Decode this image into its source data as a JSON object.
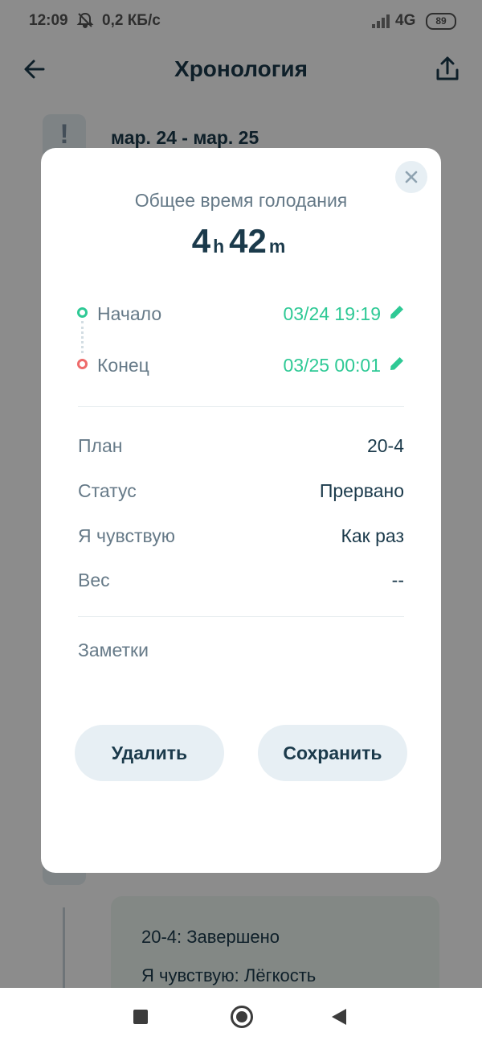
{
  "status_bar": {
    "time": "12:09",
    "speed": "0,2 КБ/с",
    "network": "4G",
    "battery": "89",
    "icons": [
      "muted-bell-icon",
      "signal-icon"
    ]
  },
  "app_bar": {
    "title": "Хронология",
    "back_icon": "arrow-left-icon",
    "share_icon": "share-icon"
  },
  "timeline": {
    "badge_mark": "!",
    "date_range": "мар. 24 - мар. 25",
    "card": {
      "line1": "20-4: Завершено",
      "line2": "Я чувствую: Лёгкость"
    }
  },
  "dialog": {
    "title": "Общее время голодания",
    "duration": {
      "hours": "4",
      "hours_unit": "h",
      "minutes": "42",
      "minutes_unit": "m"
    },
    "start": {
      "label": "Начало",
      "value": "03/24 19:19"
    },
    "end": {
      "label": "Конец",
      "value": "03/25 00:01"
    },
    "details": [
      {
        "label": "План",
        "value": "20-4"
      },
      {
        "label": "Статус",
        "value": "Прервано"
      },
      {
        "label": "Я чувствую",
        "value": "Как раз"
      },
      {
        "label": "Вес",
        "value": "--"
      }
    ],
    "notes_label": "Заметки",
    "delete_label": "Удалить",
    "save_label": "Сохранить"
  },
  "colors": {
    "accent_green": "#2ec995",
    "accent_red": "#ee6b6b",
    "text_dark": "#1b3a4b",
    "text_muted": "#667a88"
  }
}
